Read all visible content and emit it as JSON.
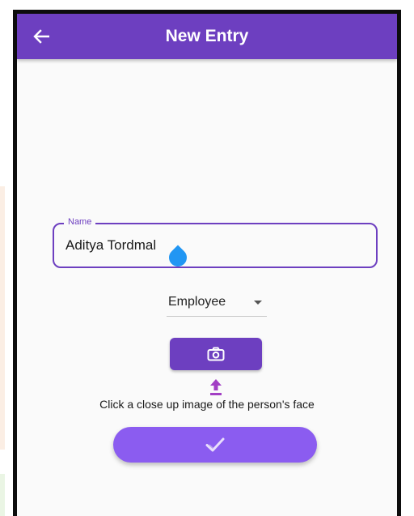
{
  "appbar": {
    "title": "New Entry",
    "back_icon": "arrow-left-icon",
    "color": "#6d3fc0"
  },
  "form": {
    "name_label": "Name",
    "name_value": "Aditya Tordmal",
    "role_selected": "Employee",
    "camera_icon": "camera-icon",
    "upload_icon": "upload-icon",
    "hint": "Click a close up image of the person's face",
    "submit_icon": "check-icon",
    "submit_color": "#8b5cf0"
  }
}
